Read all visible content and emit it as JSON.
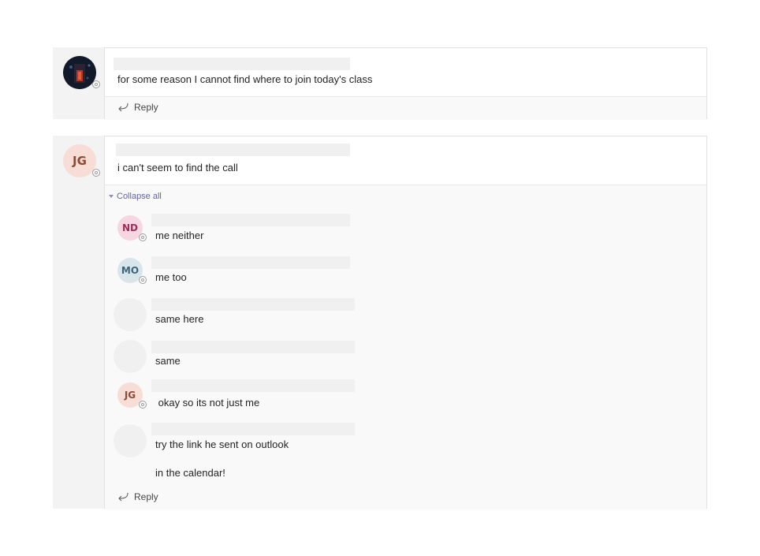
{
  "threads": [
    {
      "message": "for some reason I cannot find where to join today's class",
      "reply_label": "Reply"
    },
    {
      "avatar_initials": "JG",
      "message": "i can't seem to find the call",
      "collapse_label": "Collapse all",
      "replies": [
        {
          "avatar_initials": "ND",
          "text": "me neither"
        },
        {
          "avatar_initials": "MO",
          "text": "me too"
        },
        {
          "avatar_initials": "",
          "text": "same here"
        },
        {
          "avatar_initials": "",
          "text": "same"
        },
        {
          "avatar_initials": "JG",
          "text": " okay so its not just me"
        },
        {
          "avatar_initials": "",
          "text": "try the link he sent on outlook",
          "text2": "in the calendar!"
        }
      ],
      "reply_label": "Reply"
    }
  ],
  "colors": {
    "accent": "#6264a7",
    "jg_bg": "#f7ddd6",
    "jg_fg": "#8f4a37",
    "nd_bg": "#f6d6e1",
    "nd_fg": "#9b2f5c",
    "mo_bg": "#d8e6ec",
    "mo_fg": "#3f6478"
  }
}
